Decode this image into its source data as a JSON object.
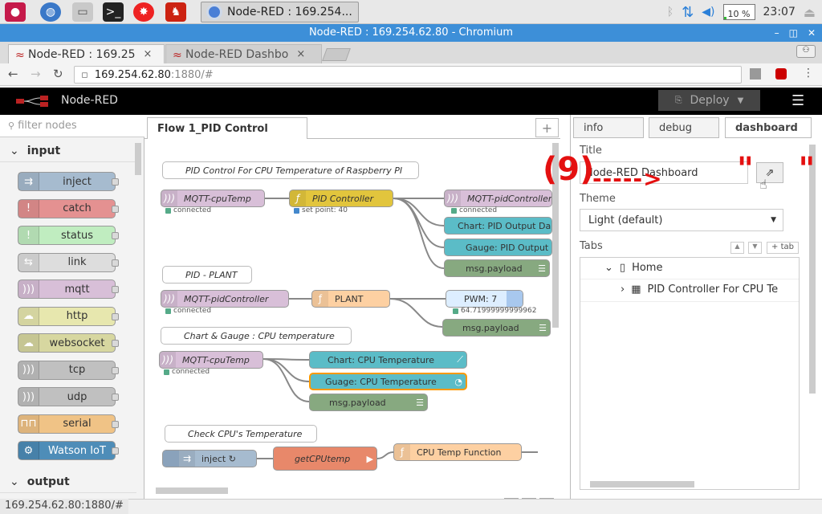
{
  "taskbar": {
    "task_title": "Node-RED : 169.254...",
    "cpu_label": "10 %",
    "cpu_level": 0.1,
    "clock": "23:07"
  },
  "window": {
    "title": "Node-RED : 169.254.62.80 - Chromium",
    "btn_min": "–",
    "btn_max": "◫",
    "btn_close": "✕"
  },
  "browser": {
    "tabs": [
      {
        "label": "Node-RED : 169.25",
        "close": "×"
      },
      {
        "label": "Node-RED Dashbo",
        "close": "×"
      }
    ],
    "url_host": "169.254.62.80",
    "url_path": ":1880/#"
  },
  "nodered": {
    "brand": "Node-RED",
    "deploy_label": "Deploy"
  },
  "palette": {
    "filter_placeholder": "filter nodes",
    "input_category": "input",
    "output_category": "output",
    "nodes": [
      {
        "label": "inject",
        "color": "#a6bbcf"
      },
      {
        "label": "catch",
        "color": "#e49191"
      },
      {
        "label": "status",
        "color": "#c0edc0"
      },
      {
        "label": "link",
        "color": "#dddddd"
      },
      {
        "label": "mqtt",
        "color": "#d8bfd8"
      },
      {
        "label": "http",
        "color": "#e7e7ae"
      },
      {
        "label": "websocket",
        "color": "#d7d7a0"
      },
      {
        "label": "tcp",
        "color": "#c0c0c0"
      },
      {
        "label": "udp",
        "color": "#c0c0c0"
      },
      {
        "label": "serial",
        "color": "#f0c386"
      },
      {
        "label": "Watson IoT",
        "color": "#4e8db8"
      }
    ]
  },
  "workspace": {
    "flow_tab": "Flow 1_PID Control",
    "add_tab": "+",
    "comments": [
      "PID Control For CPU Temperature of Raspberry PI",
      "PID - PLANT",
      "Chart & Gauge : CPU temperature",
      "Check CPU's Temperature"
    ],
    "nodes": {
      "mqtt1": "MQTT-cpuTemp",
      "pid": "PID Controller",
      "mqtt_out1": "MQTT-pidController",
      "chart1": "Chart: PID Output Da",
      "gauge1": "Gauge: PID Output",
      "debug1": "msg.payload",
      "mqtt2": "MQTT-pidController",
      "plant": "PLANT",
      "pwm": "PWM: 7",
      "debug2": "msg.payload",
      "mqtt3": "MQTT-cpuTemp",
      "chart2": "Chart: CPU Temperature",
      "gauge2": "Guage: CPU Temperature",
      "debug3": "msg.payload",
      "inject": "inject ↻",
      "getcpu": "getCPUtemp",
      "cpufunc": "CPU Temp Function"
    },
    "statuses": {
      "s1": "connected",
      "s2": "set point: 40",
      "s3": "connected",
      "s4": "connected",
      "s5": "64.71999999999962",
      "s6": "connected"
    },
    "zoom": {
      "out": "–",
      "reset": "○",
      "in": "+"
    }
  },
  "sidebar": {
    "tabs": [
      "info",
      "debug",
      "dashboard"
    ],
    "title_label": "Title",
    "title_value": "Node-RED Dashboard",
    "theme_label": "Theme",
    "theme_value": "Light (default)",
    "tabs_label": "Tabs",
    "add_tab_btn": "+ tab",
    "tree_home": "Home",
    "tree_group": "PID Controller For CPU Te"
  },
  "annotation": {
    "marker": "(9)",
    "arrow": "----->",
    "quote": "\"    \""
  },
  "statusbar": {
    "url": "169.254.62.80:1880/#"
  }
}
